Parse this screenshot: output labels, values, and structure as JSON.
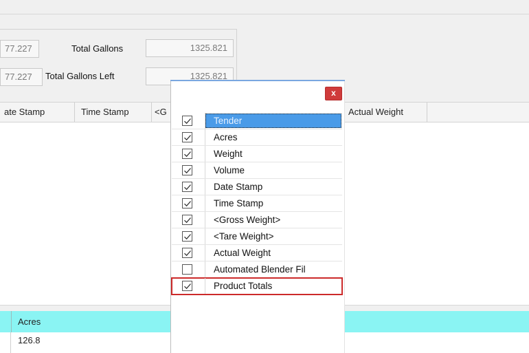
{
  "summary": {
    "row1": {
      "left_value": "77.227",
      "label": "Total Gallons",
      "right_value": "1325.821"
    },
    "row2": {
      "left_value": "77.227",
      "label": "Total Gallons Left",
      "right_value": "1325.821"
    }
  },
  "grid_header": {
    "columns": [
      "ate Stamp",
      "Time Stamp",
      "<G",
      "Actual Weight"
    ]
  },
  "popup": {
    "close_label": "x",
    "items": [
      {
        "label": "Tender",
        "checked": true
      },
      {
        "label": "Acres",
        "checked": true
      },
      {
        "label": "Weight",
        "checked": true
      },
      {
        "label": "Volume",
        "checked": true
      },
      {
        "label": "Date Stamp",
        "checked": true
      },
      {
        "label": "Time Stamp",
        "checked": true
      },
      {
        "label": "<Gross Weight>",
        "checked": true
      },
      {
        "label": "<Tare Weight>",
        "checked": true
      },
      {
        "label": "Actual Weight",
        "checked": true
      },
      {
        "label": "Automated Blender Fil",
        "checked": false
      },
      {
        "label": "Product Totals",
        "checked": true
      }
    ]
  },
  "bottom_grid": {
    "header_label": "Acres",
    "value": "126.8"
  },
  "colors": {
    "cyan_header": "#8af4f3",
    "selection": "#4a9be8",
    "highlight_outline": "#cc2a2a",
    "close_button": "#cf3b3b"
  }
}
